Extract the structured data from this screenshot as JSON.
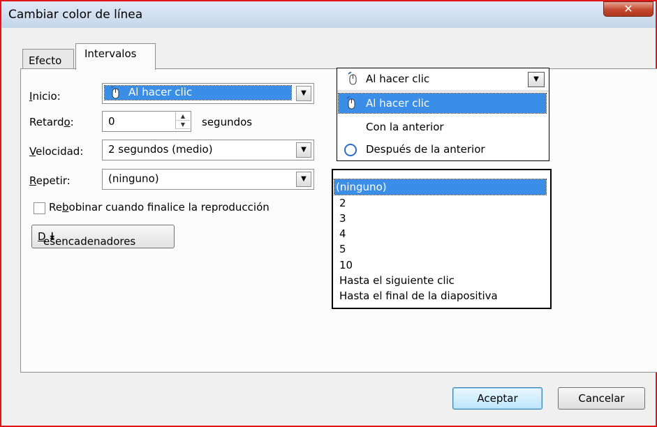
{
  "window": {
    "title": "Cambiar color de línea",
    "close_glyph": "✕"
  },
  "tabs": [
    {
      "label": "Efecto",
      "active": false
    },
    {
      "label": "Intervalos",
      "active": true
    }
  ],
  "form": {
    "inicio": {
      "label_pre": "",
      "label_u": "I",
      "label_post": "nicio:",
      "value": "Al hacer clic",
      "icon": "mouse-icon"
    },
    "retardo": {
      "label_pre": "Retard",
      "label_u": "o",
      "label_post": ":",
      "value": "0",
      "unit": "segundos"
    },
    "velocidad": {
      "label_pre": "",
      "label_u": "V",
      "label_post": "elocidad:",
      "value": "2 segundos (medio)"
    },
    "repetir": {
      "label_pre": "",
      "label_u": "R",
      "label_post": "epetir:",
      "value": "(ninguno)"
    },
    "rebobinar": {
      "label_pre": "Re",
      "label_u": "b",
      "label_post": "obinar cuando finalice la reproducción",
      "checked": false
    },
    "triggers": {
      "label_pre": "",
      "label_u": "D",
      "label_post": "esencadenadores",
      "glyph": "⯯"
    }
  },
  "inicio_dropdown": {
    "selected": "Al hacer clic",
    "options": [
      {
        "label": "Al hacer clic",
        "icon": "mouse-icon",
        "selected": true
      },
      {
        "label": "Con la anterior",
        "icon": "",
        "selected": false
      },
      {
        "label": "Después de la anterior",
        "icon": "clock-icon",
        "selected": false
      }
    ]
  },
  "repetir_dropdown": {
    "options": [
      "(ninguno)",
      "2",
      "3",
      "4",
      "5",
      "10",
      "Hasta el siguiente clic",
      "Hasta el final de la diapositiva"
    ],
    "selected_index": 0
  },
  "buttons": {
    "ok": "Aceptar",
    "cancel": "Cancelar"
  },
  "colors": {
    "selection": "#3a8ee8",
    "window_border": "#e01515"
  }
}
